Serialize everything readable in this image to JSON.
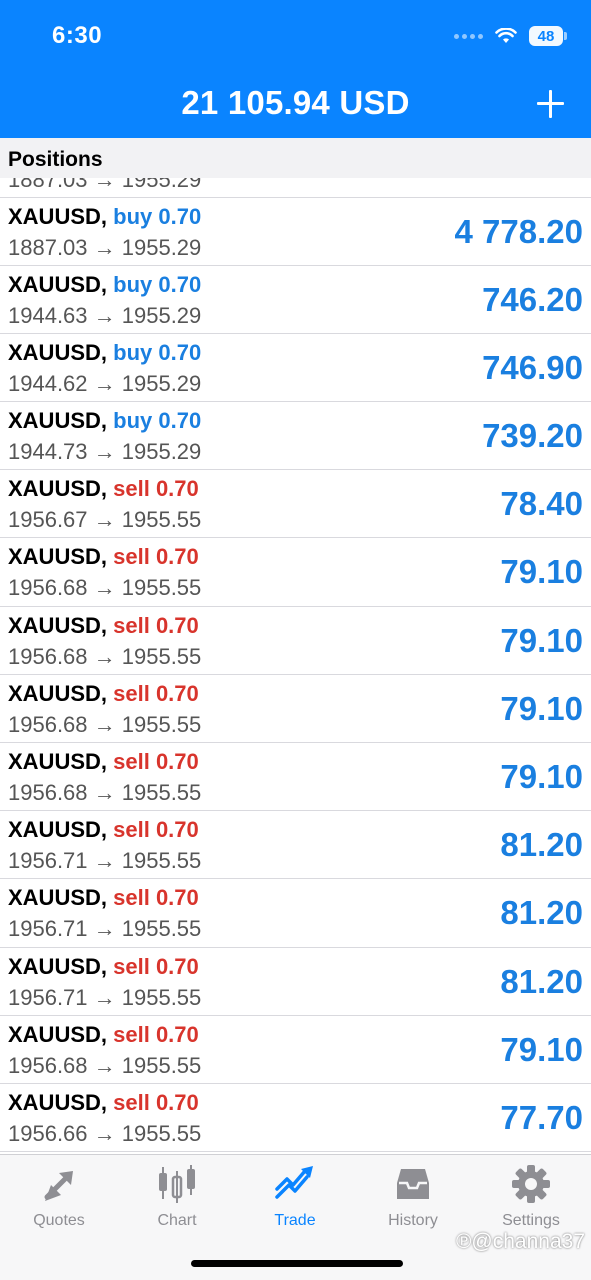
{
  "status_bar": {
    "time": "6:30",
    "battery": "48"
  },
  "header": {
    "balance": "21 105.94 USD"
  },
  "section": {
    "title": "Positions"
  },
  "partial_row": {
    "prices": "1887.03 → 1955.29"
  },
  "positions": [
    {
      "symbol": "XAUUSD,",
      "side": "buy 0.70",
      "type": "buy",
      "prices": "1887.03 → 1955.29",
      "profit": "4 778.20"
    },
    {
      "symbol": "XAUUSD,",
      "side": "buy 0.70",
      "type": "buy",
      "prices": "1944.63 → 1955.29",
      "profit": "746.20"
    },
    {
      "symbol": "XAUUSD,",
      "side": "buy 0.70",
      "type": "buy",
      "prices": "1944.62 → 1955.29",
      "profit": "746.90"
    },
    {
      "symbol": "XAUUSD,",
      "side": "buy 0.70",
      "type": "buy",
      "prices": "1944.73 → 1955.29",
      "profit": "739.20"
    },
    {
      "symbol": "XAUUSD,",
      "side": "sell 0.70",
      "type": "sell",
      "prices": "1956.67 → 1955.55",
      "profit": "78.40"
    },
    {
      "symbol": "XAUUSD,",
      "side": "sell 0.70",
      "type": "sell",
      "prices": "1956.68 → 1955.55",
      "profit": "79.10"
    },
    {
      "symbol": "XAUUSD,",
      "side": "sell 0.70",
      "type": "sell",
      "prices": "1956.68 → 1955.55",
      "profit": "79.10"
    },
    {
      "symbol": "XAUUSD,",
      "side": "sell 0.70",
      "type": "sell",
      "prices": "1956.68 → 1955.55",
      "profit": "79.10"
    },
    {
      "symbol": "XAUUSD,",
      "side": "sell 0.70",
      "type": "sell",
      "prices": "1956.68 → 1955.55",
      "profit": "79.10"
    },
    {
      "symbol": "XAUUSD,",
      "side": "sell 0.70",
      "type": "sell",
      "prices": "1956.71 → 1955.55",
      "profit": "81.20"
    },
    {
      "symbol": "XAUUSD,",
      "side": "sell 0.70",
      "type": "sell",
      "prices": "1956.71 → 1955.55",
      "profit": "81.20"
    },
    {
      "symbol": "XAUUSD,",
      "side": "sell 0.70",
      "type": "sell",
      "prices": "1956.71 → 1955.55",
      "profit": "81.20"
    },
    {
      "symbol": "XAUUSD,",
      "side": "sell 0.70",
      "type": "sell",
      "prices": "1956.68 → 1955.55",
      "profit": "79.10"
    },
    {
      "symbol": "XAUUSD,",
      "side": "sell 0.70",
      "type": "sell",
      "prices": "1956.66 → 1955.55",
      "profit": "77.70"
    }
  ],
  "tabs": [
    {
      "label": "Quotes",
      "icon": "quotes-arrows-icon",
      "active": false
    },
    {
      "label": "Chart",
      "icon": "candlestick-chart-icon",
      "active": false
    },
    {
      "label": "Trade",
      "icon": "trade-trend-icon",
      "active": true
    },
    {
      "label": "History",
      "icon": "history-inbox-icon",
      "active": false
    },
    {
      "label": "Settings",
      "icon": "gear-icon",
      "active": false
    }
  ],
  "colors": {
    "accent": "#0a84ff",
    "buy": "#1a7fe0",
    "sell": "#d8342c",
    "profit": "#1a7fe0"
  },
  "watermark": "℗@channa37"
}
